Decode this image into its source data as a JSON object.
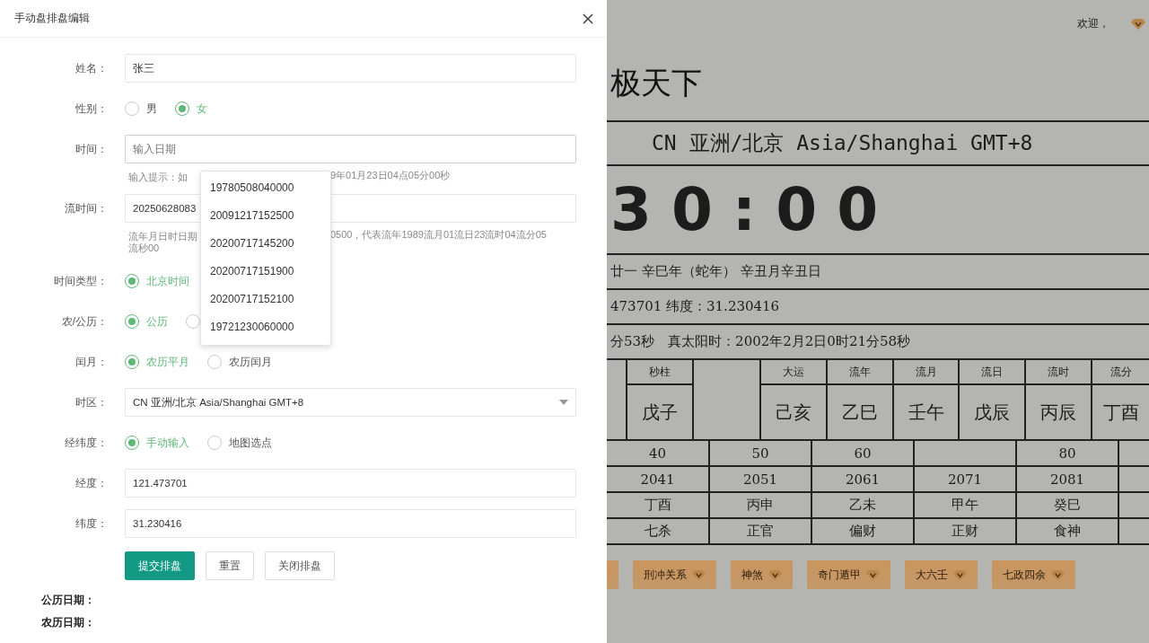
{
  "modal": {
    "title": "手动盘排盘编辑",
    "fields": [
      {
        "kind": "text",
        "label": "姓名：",
        "value": "张三"
      },
      {
        "kind": "radio",
        "label": "性别：",
        "options": [
          {
            "label": "男",
            "selected": false
          },
          {
            "label": "女",
            "selected": true
          }
        ]
      },
      {
        "kind": "text",
        "label": "时间：",
        "placeholder": "输入日期",
        "focused": true,
        "hint": [
          [
            "输入提示：如",
            "9年01月23日04点05分00秒"
          ]
        ]
      },
      {
        "kind": "text",
        "label": "流时间：",
        "value": "20250628083",
        "hint": [
          [
            "流年月日时日期",
            "0500，代表流年1989流月01流日23流时04流分05"
          ],
          [
            "流秒00"
          ]
        ]
      },
      {
        "kind": "radio",
        "label": "时间类型：",
        "options": [
          {
            "label": "北京时间",
            "selected": true
          }
        ]
      },
      {
        "kind": "radio",
        "label": "农/公历：",
        "options": [
          {
            "label": "公历",
            "selected": true
          },
          {
            "selected": false
          }
        ]
      },
      {
        "kind": "radio",
        "label": "闰月：",
        "options": [
          {
            "label": "农历平月",
            "selected": true
          },
          {
            "label": "农历闰月",
            "selected": false
          }
        ]
      },
      {
        "kind": "select",
        "label": "时区：",
        "value": "CN 亚洲/北京 Asia/Shanghai GMT+8"
      },
      {
        "kind": "radio",
        "label": "经纬度：",
        "options": [
          {
            "label": "手动输入",
            "selected": true
          },
          {
            "label": "地图选点",
            "selected": false
          }
        ]
      },
      {
        "kind": "text",
        "label": "经度：",
        "value": "121.473701"
      },
      {
        "kind": "text",
        "label": "纬度：",
        "value": "31.230416"
      }
    ],
    "buttons": [
      {
        "label": "提交排盘",
        "primary": true
      },
      {
        "label": "重置",
        "primary": false
      },
      {
        "label": "关闭排盘",
        "primary": false
      }
    ],
    "results": [
      "公历日期：",
      "农历日期："
    ],
    "suggestions": [
      "19780508040000",
      "20091217152500",
      "20200717145200",
      "20200717151900",
      "20200717152100",
      "19721230060000"
    ]
  },
  "page": {
    "welcome": "欢迎，",
    "title": "极天下",
    "timezone": "CN 亚洲/北京 Asia/Shanghai GMT+8",
    "clock": "30:00",
    "lunar": "廿一 辛巳年（蛇年） 辛丑月辛丑日",
    "coords": "473701 纬度：31.230416",
    "solar": "分53秒　真太阳时：2002年2月2日0时21分58秒",
    "pillars": [
      {
        "header": "秒柱",
        "value": "戊子"
      },
      {
        "kind": "empty"
      },
      {
        "header": "大运",
        "value": "己亥"
      },
      {
        "header": "流年",
        "value": "乙巳"
      },
      {
        "header": "流月",
        "value": "壬午"
      },
      {
        "header": "流日",
        "value": "戊辰"
      },
      {
        "header": "流时",
        "value": "丙辰"
      },
      {
        "header": "流分",
        "value": "丁酉"
      }
    ],
    "luck_rows": [
      [
        "40",
        "50",
        "60",
        "",
        "80"
      ],
      [
        "2041",
        "2051",
        "2061",
        "2071",
        "2081"
      ],
      [
        "丁酉",
        "丙申",
        "乙未",
        "甲午",
        "癸巳"
      ],
      [
        "七杀",
        "正官",
        "偏财",
        "正财",
        "食神"
      ]
    ],
    "tools": [
      "刑冲关系",
      "神煞",
      "奇门遁甲",
      "大六壬",
      "七政四余"
    ]
  }
}
